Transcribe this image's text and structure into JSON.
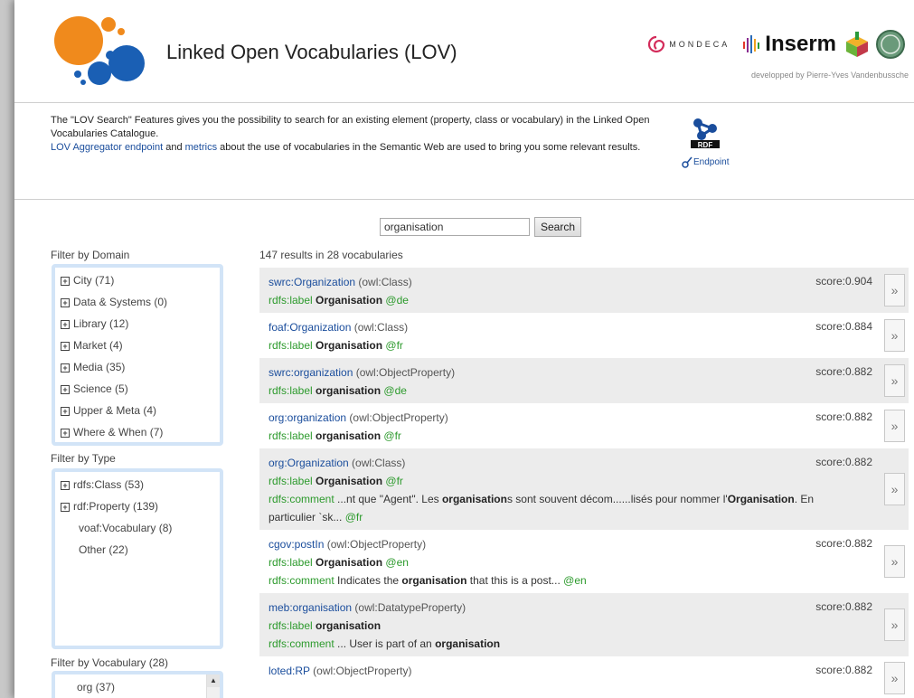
{
  "header": {
    "title": "Linked Open Vocabularies (LOV)",
    "sponsors": {
      "mondeca": "MONDECA",
      "inserm": "Inserm",
      "datalift": "DATALIFT",
      "credit": "developped by Pierre-Yves Vandenbussche"
    }
  },
  "intro": {
    "line1": "The \"LOV Search\" Features gives you the possibility to search for an existing element (property, class or vocabulary) in the Linked Open Vocabularies Catalogue.",
    "link1": "LOV Aggregator endpoint",
    "mid": " and ",
    "link2": "metrics",
    "line2": " about the use of vocabularies in the Semantic Web are used to bring you some relevant results."
  },
  "rdf": {
    "badge": "RDF",
    "label": "Endpoint"
  },
  "search": {
    "value": "organisation",
    "button": "Search"
  },
  "filters": {
    "domain": {
      "title": "Filter by Domain",
      "items": [
        "City (71)",
        "Data & Systems (0)",
        "Library (12)",
        "Market (4)",
        "Media (35)",
        "Science (5)",
        "Upper & Meta (4)",
        "Where & When (7)"
      ]
    },
    "type": {
      "title": "Filter by Type",
      "items": [
        {
          "label": "rdfs:Class (53)",
          "expandable": true
        },
        {
          "label": "rdf:Property (139)",
          "expandable": true
        },
        {
          "label": "voaf:Vocabulary (8)",
          "expandable": false
        },
        {
          "label": "Other (22)",
          "expandable": false
        }
      ]
    },
    "vocabulary": {
      "title": "Filter by Vocabulary (28)",
      "items": [
        "org (37)"
      ]
    }
  },
  "results": {
    "count": "147 results in 28 vocabularies",
    "more_label": "»",
    "items": [
      {
        "uri": "swrc:Organization",
        "type": "(owl:Class)",
        "score": "score:0.904",
        "label_key": "rdfs:label",
        "label_val": "Organisation",
        "label_lang": "@de"
      },
      {
        "uri": "foaf:Organization",
        "type": "(owl:Class)",
        "score": "score:0.884",
        "label_key": "rdfs:label",
        "label_val": "Organisation",
        "label_lang": "@fr"
      },
      {
        "uri": "swrc:organization",
        "type": "(owl:ObjectProperty)",
        "score": "score:0.882",
        "label_key": "rdfs:label",
        "label_val": "organisation",
        "label_lang": "@de"
      },
      {
        "uri": "org:organization",
        "type": "(owl:ObjectProperty)",
        "score": "score:0.882",
        "label_key": "rdfs:label",
        "label_val": "organisation",
        "label_lang": "@fr"
      },
      {
        "uri": "org:Organization",
        "type": "(owl:Class)",
        "score": "score:0.882",
        "label_key": "rdfs:label",
        "label_val": "Organisation",
        "label_lang": "@fr",
        "comment_key": "rdfs:comment",
        "comment_a": " ...nt que \"Agent\". Les ",
        "comment_b": "organisation",
        "comment_c": "s sont souvent décom......lisés pour nommer l'",
        "comment_d": "Organisation",
        "comment_e": ". En particulier `sk...",
        "comment_lang": "@fr"
      },
      {
        "uri": "cgov:postIn",
        "type": "(owl:ObjectProperty)",
        "score": "score:0.882",
        "label_key": "rdfs:label",
        "label_val": "Organisation",
        "label_lang": "@en",
        "comment_key": "rdfs:comment",
        "comment_a": " Indicates the ",
        "comment_b": "organisation",
        "comment_c": " that this is a post...",
        "comment_lang": "@en"
      },
      {
        "uri": "meb:organisation",
        "type": "(owl:DatatypeProperty)",
        "score": "score:0.882",
        "label_key": "rdfs:label",
        "label_val": "organisation",
        "label_lang": "",
        "comment_key": "rdfs:comment",
        "comment_a": " ... User is part of an ",
        "comment_b": "organisation",
        "comment_c": "",
        "comment_lang": ""
      },
      {
        "uri": "loted:RP",
        "type": "(owl:ObjectProperty)",
        "score": "score:0.882"
      }
    ]
  },
  "colors": {
    "accent_orange": "#f08a1c",
    "accent_blue": "#1a5fb4",
    "link": "#1a4d9c",
    "label_green": "#2c9a2c",
    "filter_border": "#d2e4f7"
  }
}
